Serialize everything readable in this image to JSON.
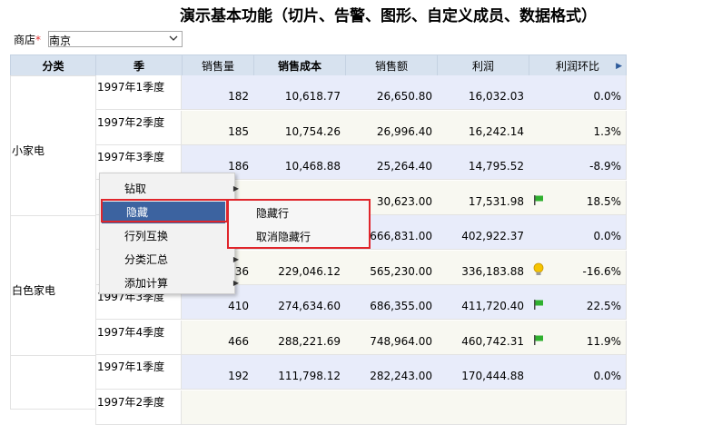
{
  "title": "演示基本功能（切片、告警、图形、自定义成员、数据格式）",
  "filter": {
    "label": "商店",
    "required_mark": "*",
    "value": "南京"
  },
  "headers": [
    "分类",
    "季",
    "销售量",
    "销售成本",
    "销售额",
    "利润",
    "利润环比"
  ],
  "categories": [
    "小家电",
    "白色家电"
  ],
  "rows": [
    {
      "quarter": "1997年1季度",
      "qty": "182",
      "cost": "10,618.77",
      "sales": "26,650.80",
      "profit": "16,032.03",
      "ratio": "0.0%",
      "icon": ""
    },
    {
      "quarter": "1997年2季度",
      "qty": "185",
      "cost": "10,754.26",
      "sales": "26,996.40",
      "profit": "16,242.14",
      "ratio": "1.3%",
      "icon": ""
    },
    {
      "quarter": "1997年3季度",
      "qty": "186",
      "cost": "10,468.88",
      "sales": "25,264.40",
      "profit": "14,795.52",
      "ratio": "-8.9%",
      "icon": ""
    },
    {
      "quarter": "",
      "qty": "",
      "cost": "",
      "sales": "30,623.00",
      "profit": "17,531.98",
      "ratio": "18.5%",
      "icon": "green-flag-icon"
    },
    {
      "quarter": "",
      "qty": "",
      "cost": "",
      "sales": "666,831.00",
      "profit": "402,922.37",
      "ratio": "0.0%",
      "icon": ""
    },
    {
      "quarter": "",
      "qty": "36",
      "cost": "229,046.12",
      "sales": "565,230.00",
      "profit": "336,183.88",
      "ratio": "-16.6%",
      "icon": "lightbulb-icon"
    },
    {
      "quarter": "1997年3季度",
      "qty": "410",
      "cost": "274,634.60",
      "sales": "686,355.00",
      "profit": "411,720.40",
      "ratio": "22.5%",
      "icon": "green-flag-icon"
    },
    {
      "quarter": "1997年4季度",
      "qty": "466",
      "cost": "288,221.69",
      "sales": "748,964.00",
      "profit": "460,742.31",
      "ratio": "11.9%",
      "icon": "green-flag-icon"
    },
    {
      "quarter": "1997年1季度",
      "qty": "192",
      "cost": "111,798.12",
      "sales": "282,243.00",
      "profit": "170,444.88",
      "ratio": "0.0%",
      "icon": ""
    },
    {
      "quarter": "1997年2季度",
      "qty": "",
      "cost": "",
      "sales": "",
      "profit": "",
      "ratio": "",
      "icon": ""
    }
  ],
  "context_menu": {
    "items": [
      {
        "label": "钻取",
        "has_submenu": true
      },
      {
        "label": "隐藏",
        "has_submenu": true,
        "active": true
      },
      {
        "label": "行列互换",
        "has_submenu": false
      },
      {
        "label": "分类汇总",
        "has_submenu": true
      },
      {
        "label": "添加计算",
        "has_submenu": true
      }
    ],
    "submenu": [
      "隐藏行",
      "取消隐藏行"
    ]
  },
  "colors": {
    "header_bg": "#d7e2ef",
    "row_blue": "#e8ecfa",
    "row_cream": "#f8f8f1",
    "highlight": "#3c63a0",
    "outline_red": "#e0252b",
    "flag_green": "#2fb02f"
  }
}
